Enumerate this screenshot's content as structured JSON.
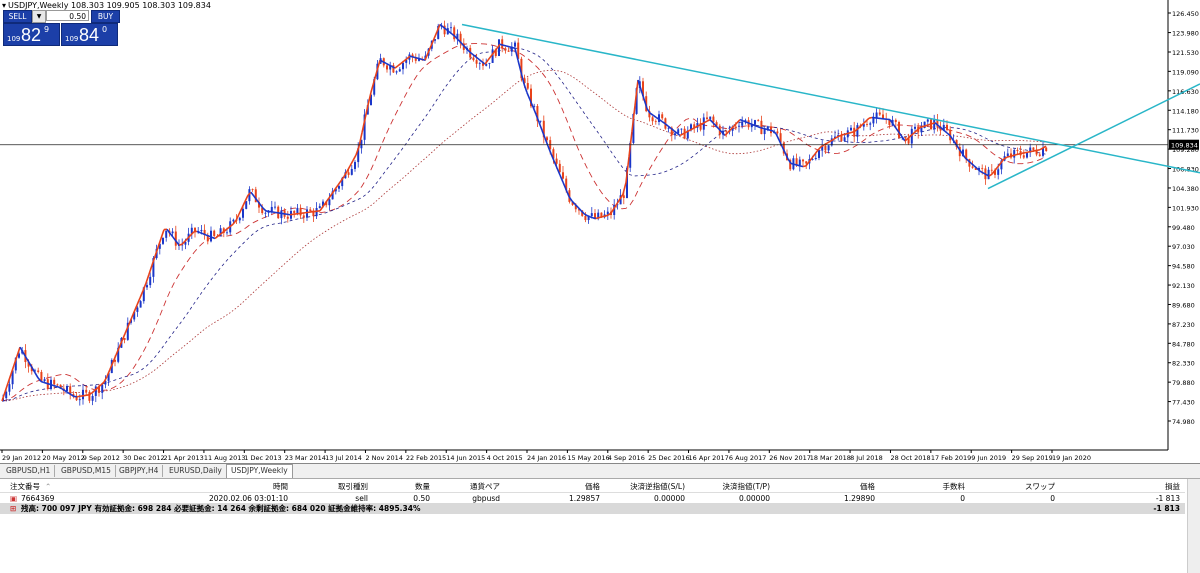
{
  "chart": {
    "title": "USDJPY,Weekly  108.303 109.905 108.303 109.834",
    "current_price": "109.834",
    "price_ticks": [
      "126.450",
      "123.980",
      "121.530",
      "119.090",
      "116.630",
      "114.180",
      "111.730",
      "109.280",
      "106.830",
      "104.380",
      "101.930",
      "99.480",
      "97.030",
      "94.580",
      "92.130",
      "89.680",
      "87.230",
      "84.780",
      "82.330",
      "79.880",
      "77.430",
      "74.980"
    ],
    "date_ticks": [
      "29 Jan 2012",
      "20 May 2012",
      "9 Sep 2012",
      "30 Dec 2012",
      "21 Apr 2013",
      "11 Aug 2013",
      "1 Dec 2013",
      "23 Mar 2014",
      "13 Jul 2014",
      "2 Nov 2014",
      "22 Feb 2015",
      "14 Jun 2015",
      "4 Oct 2015",
      "24 Jan 2016",
      "15 May 2016",
      "4 Sep 2016",
      "25 Dec 2016",
      "16 Apr 2017",
      "6 Aug 2017",
      "26 Nov 2017",
      "18 Mar 2018",
      "8 Jul 2018",
      "28 Oct 2018",
      "17 Feb 2019",
      "9 Jun 2019",
      "29 Sep 2019",
      "19 Jan 2020"
    ],
    "colors": {
      "bull": "#1a36c9",
      "bear": "#e8421a",
      "trendline": "#29b6c8",
      "ma_fast": "#cc3333",
      "ma_slow": "#222288",
      "hline": "#222222"
    }
  },
  "one_click": {
    "sell_label": "SELL",
    "buy_label": "BUY",
    "lot": "0.50",
    "sell_small": "109",
    "sell_big": "82",
    "sell_sup": "9",
    "buy_small": "109",
    "buy_big": "84",
    "buy_sup": "0"
  },
  "tabs": [
    "GBPUSD,H1",
    "GBPUSD,M15",
    "GBPJPY,H4",
    "EURUSD,Daily",
    "USDJPY,Weekly"
  ],
  "terminal": {
    "headers": [
      "注文番号",
      "時間",
      "取引種別",
      "数量",
      "通貨ペア",
      "価格",
      "決済逆指値(S/L)",
      "決済指値(T/P)",
      "価格",
      "手数料",
      "スワップ",
      "損益"
    ],
    "order": {
      "ticket": "7664369",
      "time": "2020.02.06 03:01:10",
      "type": "sell",
      "size": "0.50",
      "symbol": "gbpusd",
      "price": "1.29857",
      "sl": "0.00000",
      "tp": "0.00000",
      "current": "1.29890",
      "commission": "0",
      "swap": "0",
      "profit": "-1 813"
    },
    "summary": "残高: 700 097 JPY  有効証拠金: 698 284  必要証拠金: 14 264  余剰証拠金: 684 020  証拠金維持率: 4895.34%",
    "summary_profit": "-1 813"
  }
}
